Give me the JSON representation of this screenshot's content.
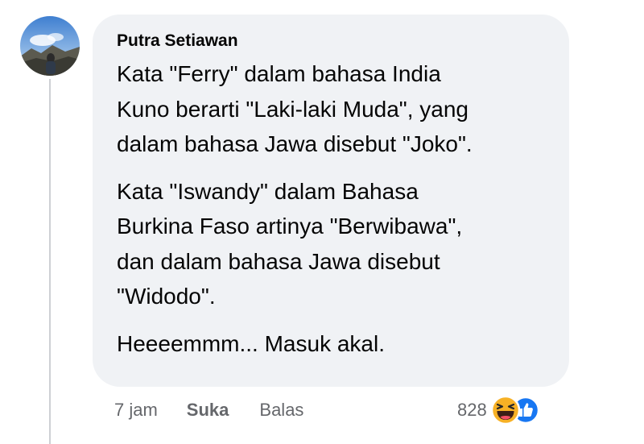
{
  "comment": {
    "author": "Putra Setiawan",
    "paragraphs": [
      "Kata \"Ferry\" dalam bahasa India\nKuno berarti \"Laki-laki Muda\", yang\ndalam bahasa Jawa disebut \"Joko\".",
      "Kata \"Iswandy\" dalam Bahasa\nBurkina Faso artinya \"Berwibawa\",\ndan dalam bahasa Jawa disebut\n\"Widodo\".",
      "Heeeemmm... Masuk akal."
    ]
  },
  "actions": {
    "time": "7 jam",
    "like_label": "Suka",
    "reply_label": "Balas"
  },
  "reactions": {
    "count": "828",
    "icons": [
      "haha-icon",
      "like-icon"
    ]
  },
  "colors": {
    "bubble": "#f0f2f5",
    "text": "#050505",
    "secondary": "#65676b",
    "like_blue": "#1877f2",
    "haha_yellow": "#f7b125"
  }
}
